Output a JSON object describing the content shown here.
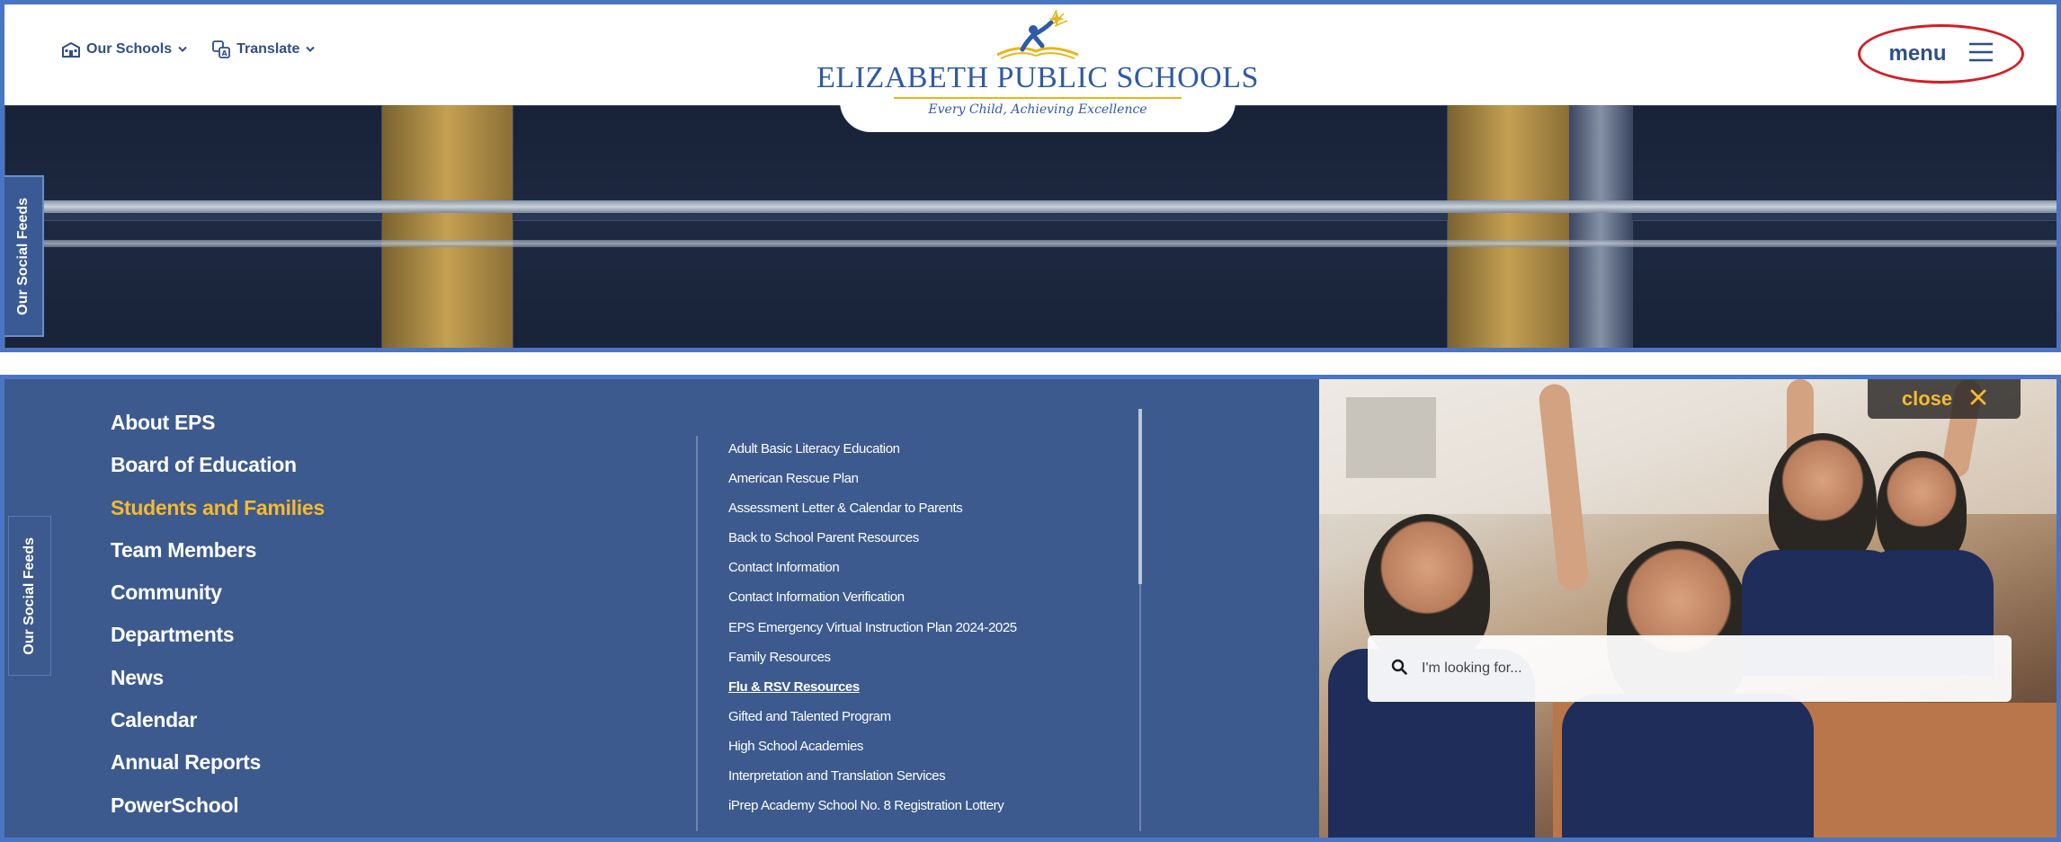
{
  "header": {
    "nav": [
      {
        "label": "Our Schools",
        "icon": "school-building-icon"
      },
      {
        "label": "Translate",
        "icon": "translate-icon"
      }
    ],
    "logo": {
      "title": "ELIZABETH PUBLIC SCHOOLS",
      "tagline": "Every Child, Achieving Excellence"
    },
    "menu_label": "menu",
    "social_tab": "Our Social Feeds"
  },
  "menu_panel": {
    "social_tab": "Our Social Feeds",
    "primary": [
      "About EPS",
      "Board of Education",
      "Students and Families",
      "Team Members",
      "Community",
      "Departments",
      "News",
      "Calendar",
      "Annual Reports",
      "PowerSchool"
    ],
    "active_index": 2,
    "submenu": [
      "Adult Basic Literacy Education",
      "American Rescue Plan",
      "Assessment Letter & Calendar to Parents",
      "Back to School Parent Resources",
      "Contact Information",
      "Contact Information Verification",
      "EPS Emergency Virtual Instruction Plan 2024-2025",
      "Family Resources",
      "Flu & RSV Resources",
      "Gifted and Talented Program",
      "High School Academies",
      "Interpretation and Translation Services",
      "iPrep Academy School No. 8 Registration Lottery"
    ],
    "current_sub_index": 8,
    "close_label": "close",
    "search_placeholder": "I'm looking for..."
  },
  "colors": {
    "brand_blue": "#3c5a8e",
    "accent_yellow": "#f5b930",
    "frame_blue": "#4a75c4",
    "highlight_red": "#d21f26"
  }
}
